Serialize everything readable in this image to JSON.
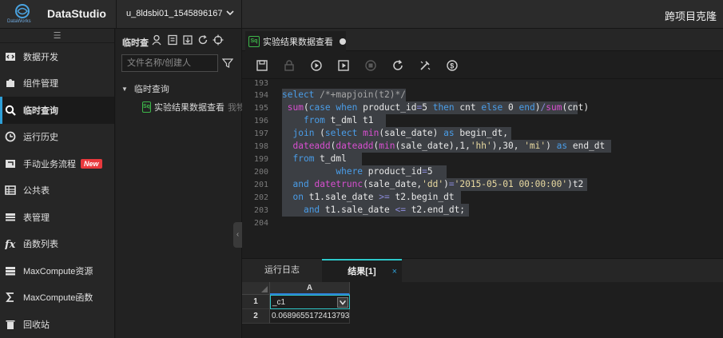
{
  "app": {
    "brand": "DataStudio",
    "logo_text": "DataWorks",
    "project": "u_8ldsbi01_1545896167",
    "top_right": "跨项目克隆"
  },
  "nav": {
    "items": [
      {
        "label": "数据开发",
        "icon": "code-icon"
      },
      {
        "label": "组件管理",
        "icon": "puzzle-icon"
      },
      {
        "label": "临时查询",
        "icon": "search-icon",
        "active": true
      },
      {
        "label": "运行历史",
        "icon": "clock-icon"
      },
      {
        "label": "手动业务流程",
        "icon": "flow-icon",
        "badge": "New"
      },
      {
        "label": "公共表",
        "icon": "table-icon"
      },
      {
        "label": "表管理",
        "icon": "table-manage-icon"
      },
      {
        "label": "函数列表",
        "icon": "function-icon"
      },
      {
        "label": "MaxCompute资源",
        "icon": "resource-icon"
      },
      {
        "label": "MaxCompute函数",
        "icon": "sigma-icon"
      },
      {
        "label": "回收站",
        "icon": "trash-icon"
      }
    ]
  },
  "explorer": {
    "title": "临时查",
    "search_placeholder": "文件名称/创建人",
    "tree_root": "临时查询",
    "file_name": "实验结果数据查看",
    "file_owner": "我物"
  },
  "editor": {
    "tab_label": "实验结果数据查看",
    "file_type": "Sq",
    "line_numbers": [
      "193",
      "194",
      "195",
      "196",
      "197",
      "198",
      "199",
      "200",
      "201",
      "202",
      "203",
      "204"
    ]
  },
  "results": {
    "tabs": [
      "运行日志",
      "结果[1]"
    ],
    "close": "×",
    "column": "A",
    "rows": [
      {
        "num": "1",
        "value": "_c1"
      },
      {
        "num": "2",
        "value": "0.0689655172413793"
      }
    ]
  },
  "colors": {
    "accent": "#2e9fd7",
    "keyword": "#4a9de8",
    "function": "#d84fd0",
    "string": "#e8d9a0",
    "new_badge": "#e8393d"
  }
}
